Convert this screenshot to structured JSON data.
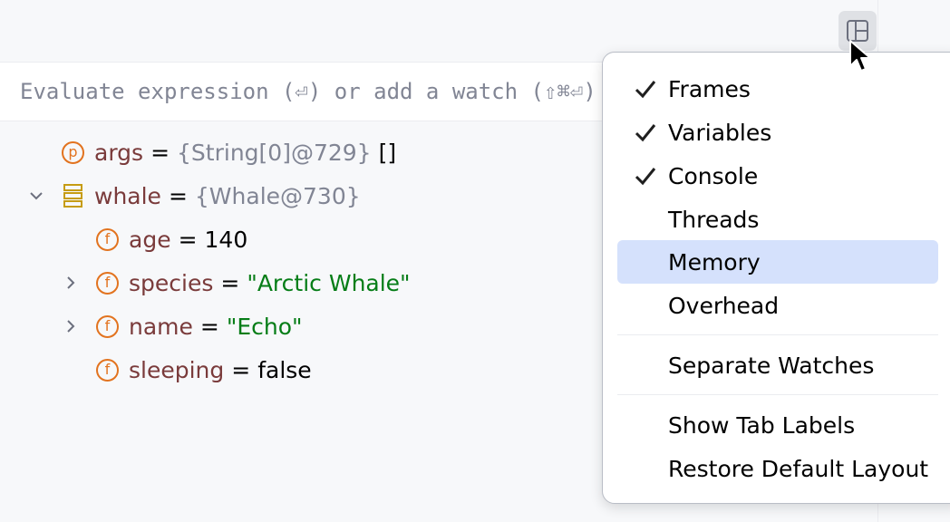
{
  "evaluate": {
    "placeholder": "Evaluate expression (⏎) or add a watch (⇧⌘⏎)"
  },
  "toolbar": {
    "layout_button_icon": "layout-icon"
  },
  "variables": [
    {
      "badge": "p",
      "name": "args",
      "eq": "=",
      "value": "{String[0]@729}",
      "extra": "[]"
    },
    {
      "icon": "stack-icon",
      "name": "whale",
      "eq": "=",
      "value": "{Whale@730}",
      "expanded": true
    },
    {
      "badge": "f",
      "name": "age",
      "eq": "=",
      "value": "140"
    },
    {
      "badge": "f",
      "name": "species",
      "eq": "=",
      "value": "\"Arctic Whale\"",
      "collapsed": true
    },
    {
      "badge": "f",
      "name": "name",
      "eq": "=",
      "value": "\"Echo\"",
      "collapsed": true
    },
    {
      "badge": "f",
      "name": "sleeping",
      "eq": "=",
      "value": "false"
    }
  ],
  "menu": {
    "items": [
      {
        "label": "Frames",
        "checked": true
      },
      {
        "label": "Variables",
        "checked": true
      },
      {
        "label": "Console",
        "checked": true
      },
      {
        "label": "Threads",
        "checked": false
      },
      {
        "label": "Memory",
        "checked": false,
        "selected": true
      },
      {
        "label": "Overhead",
        "checked": false
      },
      {
        "label": "Separate Watches",
        "checked": false
      },
      {
        "label": "Show Tab Labels",
        "checked": false
      },
      {
        "label": "Restore Default Layout",
        "checked": false
      }
    ]
  },
  "colors": {
    "background": "#f7f8fa",
    "badge": "#e2731f",
    "var_name": "#7a3b3b",
    "string_value": "#067d17",
    "ref_value": "#818594",
    "menu_selected": "#d5e1fc"
  }
}
